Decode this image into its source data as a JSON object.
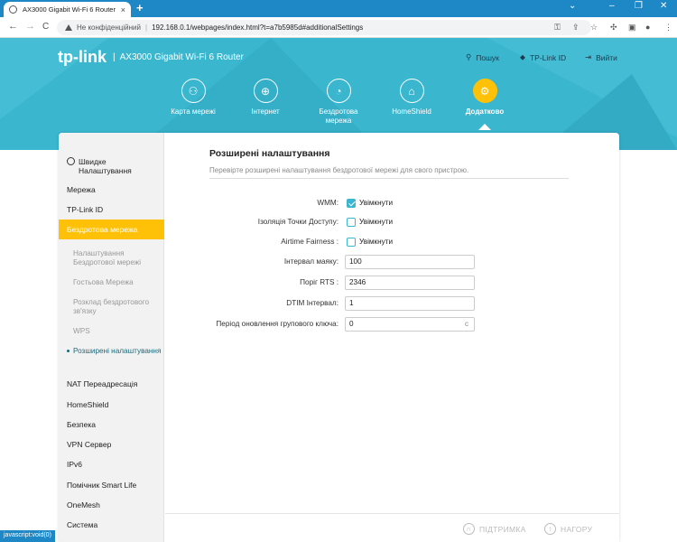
{
  "browser": {
    "tab_title": "AX3000 Gigabit Wi-Fi 6 Router",
    "tab_close": "×",
    "new_tab": "+",
    "win_min": "⌄",
    "win_minimize": "–",
    "win_restore": "❐",
    "win_close": "✕",
    "back": "←",
    "forward": "→",
    "reload": "C",
    "security": "Не конфіденційний",
    "separator": "|",
    "url": "192.168.0.1/webpages/index.html?t=a7b5985d#additionalSettings",
    "toolbar_icons": [
      "key-icon",
      "share-icon",
      "star-icon",
      "extensions-icon",
      "sidepanel-icon",
      "profile-icon",
      "menu-icon"
    ]
  },
  "header": {
    "logo": "tp-link",
    "pipe": "|",
    "model": "AX3000 Gigabit Wi-Fi 6 Router",
    "search": "Пошук",
    "tplink_id": "TP-Link ID",
    "logout": "Вийти"
  },
  "topnav": [
    {
      "label": "Карта мережі",
      "icon": "network-map-icon",
      "glyph": "⚇"
    },
    {
      "label": "Інтернет",
      "icon": "globe-icon",
      "glyph": "⊕"
    },
    {
      "label": "Бездротова мережа",
      "icon": "wifi-icon",
      "glyph": "◔"
    },
    {
      "label": "HomeShield",
      "icon": "homeshield-icon",
      "glyph": "⌂"
    },
    {
      "label": "Додатково",
      "icon": "gear-icon",
      "glyph": "⚙",
      "active": true
    }
  ],
  "sidebar": {
    "quick": "Швидке Налаштування",
    "items": [
      "Мережа",
      "TP-Link ID",
      "Бездротова мережа",
      "NAT Переадресація",
      "HomeShield",
      "Безпека",
      "VPN Сервер",
      "IPv6",
      "Помічник Smart Life",
      "OneMesh",
      "Система"
    ],
    "sub": [
      "Налаштування Бездротової мережі",
      "Гостьова Мережа",
      "Розклад бездротового зв'язку",
      "WPS",
      "Розширені налаштування"
    ]
  },
  "content": {
    "title": "Розширені налаштування",
    "desc": "Перевірте розширені налаштування бездротової мережі для свого пристрою.",
    "wmm_label": "WMM:",
    "wmm_value": "Увімкнути",
    "wmm_checked": true,
    "ap_isolation_label": "Ізоляція Точки Доступу:",
    "ap_isolation_value": "Увімкнути",
    "ap_isolation_checked": false,
    "airtime_label": "Airtime Fairness :",
    "airtime_value": "Увімкнути",
    "airtime_checked": false,
    "beacon_label": "Інтервал маяку:",
    "beacon_value": "100",
    "rts_label": "Поріг RTS :",
    "rts_value": "2346",
    "dtim_label": "DTIM Інтервал:",
    "dtim_value": "1",
    "gkey_label": "Період оновлення групового ключа:",
    "gkey_value": "0",
    "gkey_unit": "c"
  },
  "footer": {
    "support": "ПІДТРИМКА",
    "top": "НАГОРУ"
  },
  "status": "javascript:void(0)",
  "colors": {
    "accent": "#3ab6cf",
    "active": "#ffc107",
    "tabstrip": "#1e88c7"
  }
}
